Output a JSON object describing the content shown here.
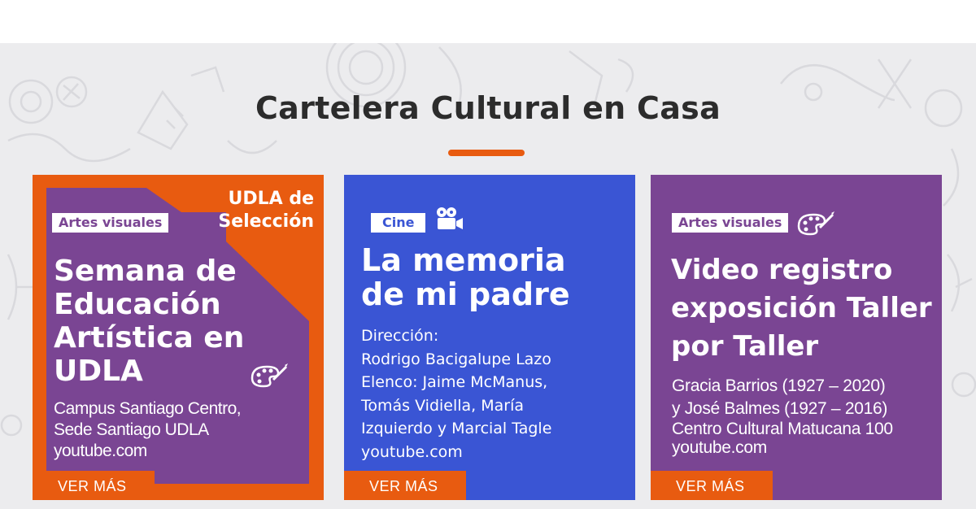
{
  "section": {
    "title": "Cartelera Cultural en Casa",
    "accent_color": "#e85b10"
  },
  "cards": [
    {
      "category": "Artes visuales",
      "badge_line1": "UDLA de",
      "badge_line2": "Selección",
      "title_lines": [
        "Semana de",
        "Educación",
        "Artística en",
        "UDLA"
      ],
      "info_lines": [
        "Campus Santiago Centro,",
        "Sede Santiago UDLA",
        "youtube.com"
      ],
      "icon": "palette-icon",
      "button": "VER MÁS",
      "colors": {
        "bg": "#e85b10",
        "panel": "#7a4593",
        "tag_text": "#7a4593"
      }
    },
    {
      "category": "Cine",
      "title_lines": [
        "La memoria",
        "de mi padre"
      ],
      "info_lines": [
        "Dirección:",
        "Rodrigo Bacigalupe Lazo",
        "Elenco: Jaime McManus,",
        "Tomás Vidiella, María",
        "Izquierdo y Marcial Tagle",
        "youtube.com"
      ],
      "icon": "movie-camera-icon",
      "button": "VER MÁS",
      "colors": {
        "bg": "#3a55d4",
        "tag_text": "#3a55d4"
      }
    },
    {
      "category": "Artes visuales",
      "title_lines": [
        "Video registro",
        "exposición Taller",
        "por Taller"
      ],
      "info_lines": [
        "Gracia Barrios (1927 – 2020)",
        "y José Balmes (1927 – 2016)",
        "Centro Cultural Matucana 100",
        "youtube.com"
      ],
      "icon": "palette-icon",
      "button": "VER MÁS",
      "colors": {
        "bg": "#7a4593",
        "tag_text": "#7a4593"
      }
    }
  ]
}
